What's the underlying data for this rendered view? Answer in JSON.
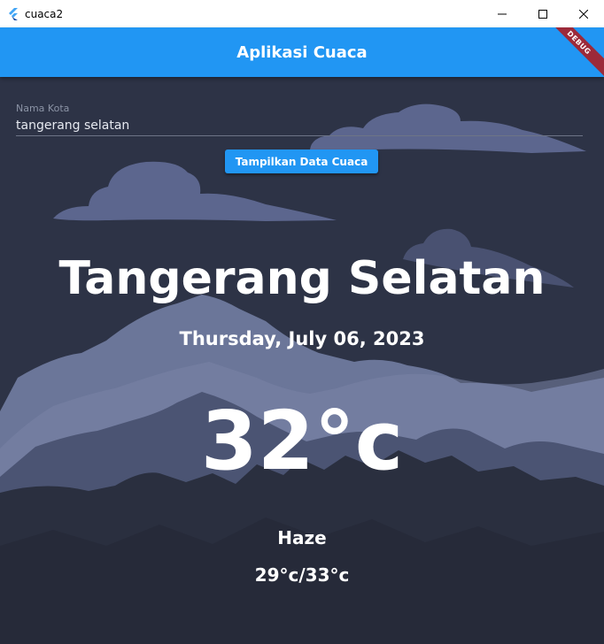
{
  "window": {
    "title": "cuaca2",
    "icon": "flutter-logo-icon",
    "controls": [
      "minimize-icon",
      "maximize-icon",
      "close-icon"
    ]
  },
  "appbar": {
    "title": "Aplikasi Cuaca",
    "color": "#2196f3",
    "debug_banner": "DEBUG"
  },
  "form": {
    "label": "Nama Kota",
    "value": "tangerang selatan",
    "button_label": "Tampilkan Data Cuaca"
  },
  "weather": {
    "city": "Tangerang Selatan",
    "date": "Thursday, July 06, 2023",
    "temperature": "32°c",
    "description": "Haze",
    "range": "29°c/33°c"
  },
  "colors": {
    "background": "#2b3142",
    "mountain_light": "#6b7699",
    "mountain_mid": "#4b5473",
    "mountain_dark": "#262a39",
    "cloud": "#5c668e"
  }
}
